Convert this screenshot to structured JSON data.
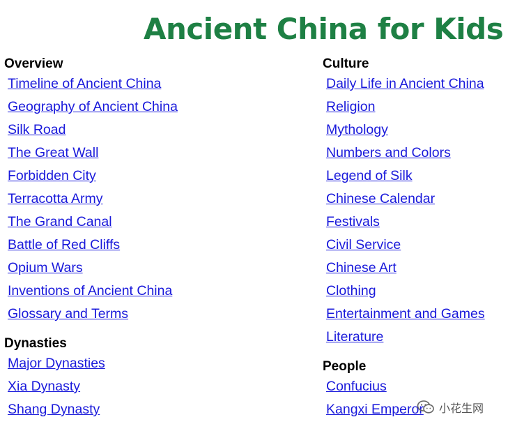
{
  "page": {
    "title": "Ancient China for Kids"
  },
  "colors": {
    "title": "#1e8044",
    "link": "#1a1adb",
    "heading": "#000000"
  },
  "left_column": {
    "overview": {
      "heading": "Overview",
      "links": [
        "Timeline of Ancient China",
        "Geography of Ancient China",
        "Silk Road",
        "The Great Wall",
        "Forbidden City",
        "Terracotta Army",
        "The Grand Canal",
        "Battle of Red Cliffs",
        "Opium Wars",
        "Inventions of Ancient China",
        "Glossary and Terms"
      ]
    },
    "dynasties": {
      "heading": "Dynasties",
      "links": [
        "Major Dynasties",
        "Xia Dynasty",
        "Shang Dynasty"
      ]
    }
  },
  "right_column": {
    "culture": {
      "heading": "Culture",
      "links": [
        "Daily Life in Ancient China",
        "Religion",
        "Mythology",
        "Numbers and Colors",
        "Legend of Silk",
        "Chinese Calendar",
        "Festivals",
        "Civil Service",
        "Chinese Art",
        "Clothing",
        "Entertainment and Games",
        "Literature"
      ]
    },
    "people": {
      "heading": "People",
      "links": [
        "Confucius",
        "Kangxi Emperor"
      ]
    }
  },
  "watermark": {
    "text": "小花生网",
    "icon": "wechat-icon"
  }
}
